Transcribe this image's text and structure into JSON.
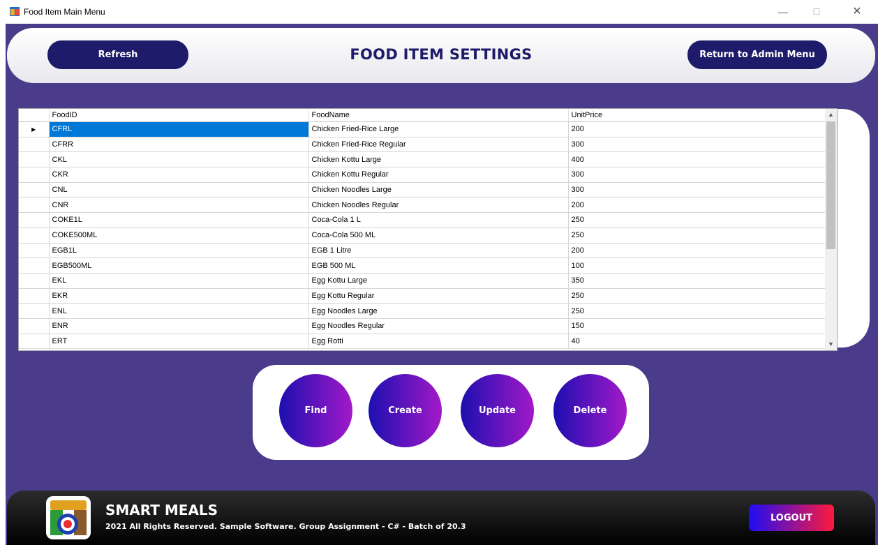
{
  "window": {
    "title": "Food Item Main Menu",
    "minimize": "—",
    "maximize": "☐",
    "close": "✕"
  },
  "header": {
    "refresh_label": "Refresh",
    "title": "FOOD ITEM SETTINGS",
    "return_label": "Return to Admin Menu"
  },
  "grid": {
    "columns": [
      "FoodID",
      "FoodName",
      "UnitPrice"
    ],
    "current_row_marker": "▶",
    "rows": [
      [
        "CFRL",
        "Chicken Fried-Rice Large",
        "200"
      ],
      [
        "CFRR",
        "Chicken Fried-Rice Regular",
        "300"
      ],
      [
        "CKL",
        "Chicken Kottu Large",
        "400"
      ],
      [
        "CKR",
        "Chicken Kottu Regular",
        "300"
      ],
      [
        "CNL",
        "Chicken Noodles Large",
        "300"
      ],
      [
        "CNR",
        "Chicken Noodles Regular",
        "200"
      ],
      [
        "COKE1L",
        "Coca-Cola 1 L",
        "250"
      ],
      [
        "COKE500ML",
        "Coca-Cola 500 ML",
        "250"
      ],
      [
        "EGB1L",
        "EGB 1 Litre",
        "200"
      ],
      [
        "EGB500ML",
        "EGB 500 ML",
        "100"
      ],
      [
        "EKL",
        "Egg Kottu Large",
        "350"
      ],
      [
        "EKR",
        "Egg Kottu Regular",
        "250"
      ],
      [
        "ENL",
        "Egg Noodles Large",
        "250"
      ],
      [
        "ENR",
        "Egg Noodles Regular",
        "150"
      ],
      [
        "ERT",
        "Egg Rotti",
        "40"
      ]
    ],
    "scroll_up": "▲",
    "scroll_down": "▼"
  },
  "actions": {
    "find_label": "Find",
    "create_label": "Create",
    "update_label": "Update",
    "delete_label": "Delete"
  },
  "footer": {
    "brand": "SMART MEALS",
    "copyright": "2021 All Rights Reserved.  Sample Software. Group Assignment - C# - Batch of 20.3",
    "logout_label": "LOGOUT"
  },
  "colors": {
    "background": "#4a3c8a",
    "navy": "#1d1b6a",
    "selection": "#0078d7",
    "gradient_start": "#1c0fb0",
    "gradient_end": "#a319c8"
  }
}
